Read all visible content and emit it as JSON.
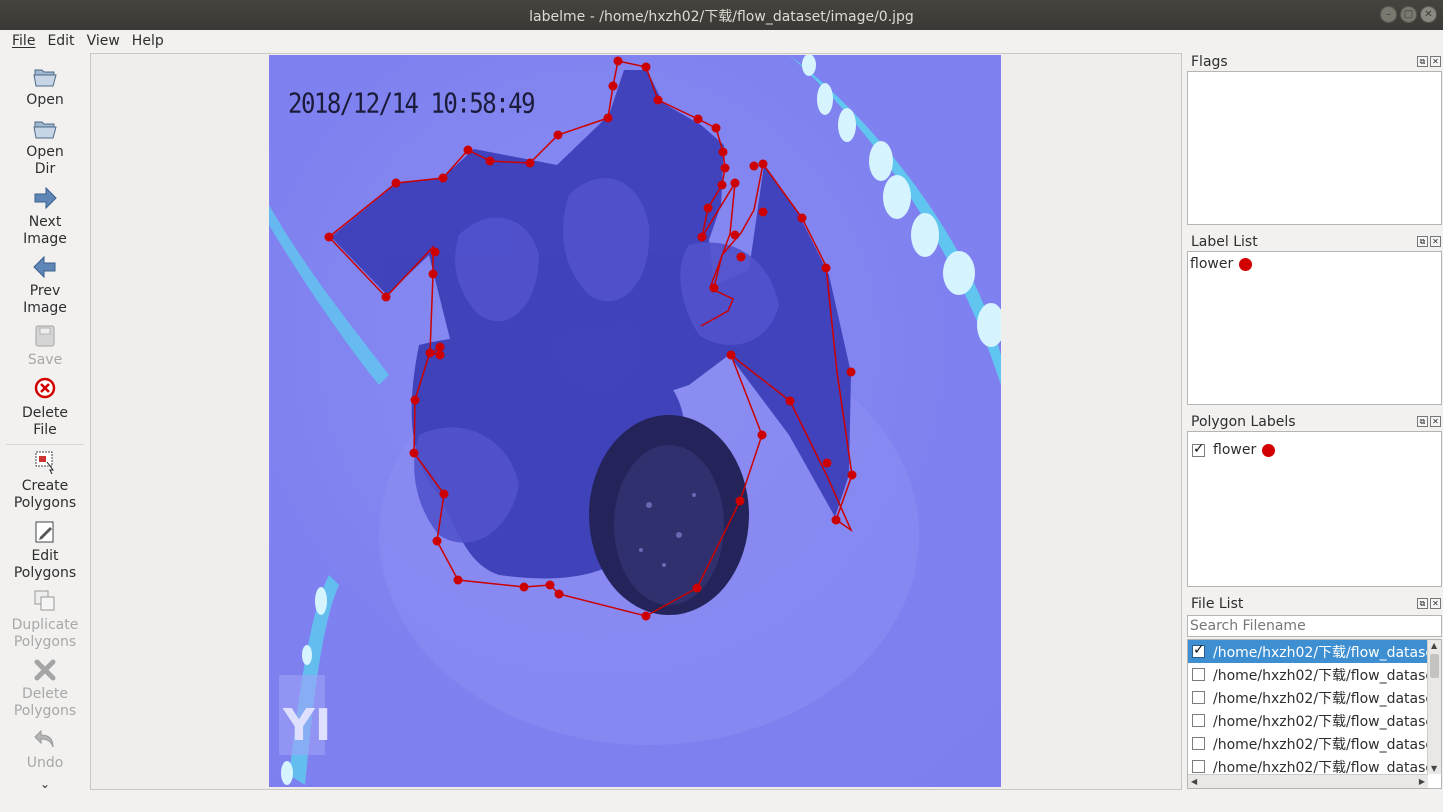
{
  "window": {
    "title": "labelme - /home/hxzh02/下载/flow_dataset/image/0.jpg"
  },
  "menu": [
    {
      "label": "File"
    },
    {
      "label": "Edit"
    },
    {
      "label": "View"
    },
    {
      "label": "Help"
    }
  ],
  "tools": {
    "open": "Open",
    "open_dir": "Open\nDir",
    "next_image": "Next\nImage",
    "prev_image": "Prev\nImage",
    "save": "Save",
    "delete_file": "Delete\nFile",
    "create_polygons": "Create\nPolygons",
    "edit_polygons": "Edit\nPolygons",
    "duplicate_polygons": "Duplicate\nPolygons",
    "delete_polygons": "Delete\nPolygons",
    "undo": "Undo",
    "more": "⌄"
  },
  "image": {
    "timestamp": "2018/12/14  10:58:49",
    "watermark": "YI"
  },
  "annotation": {
    "label": "flower",
    "color": "#d20000"
  },
  "docks": {
    "flags": {
      "title": "Flags"
    },
    "label_list": {
      "title": "Label List",
      "items": [
        {
          "label": "flower",
          "color": "#d20000"
        }
      ]
    },
    "polygon_labels": {
      "title": "Polygon Labels",
      "items": [
        {
          "label": "flower",
          "checked": true,
          "color": "#d20000"
        }
      ]
    },
    "file_list": {
      "title": "File List",
      "search_placeholder": "Search Filename",
      "files": [
        {
          "path": "/home/hxzh02/下载/flow_datase",
          "checked": true,
          "selected": true
        },
        {
          "path": "/home/hxzh02/下载/flow_datase",
          "checked": false
        },
        {
          "path": "/home/hxzh02/下载/flow_datase",
          "checked": false
        },
        {
          "path": "/home/hxzh02/下载/flow_datase",
          "checked": false
        },
        {
          "path": "/home/hxzh02/下载/flow_datase",
          "checked": false
        },
        {
          "path": "/home/hxzh02/下载/flow_datase",
          "checked": false
        }
      ]
    }
  }
}
